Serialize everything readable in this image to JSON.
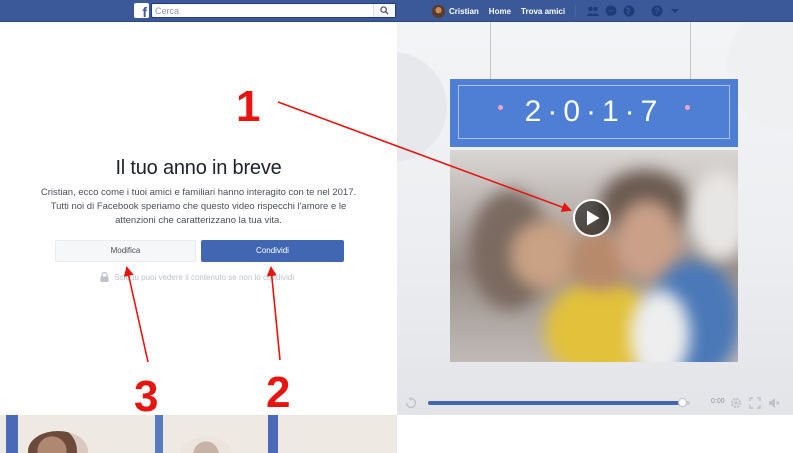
{
  "topbar": {
    "logo_letter": "f",
    "search_placeholder": "Cerca",
    "user_name": "Cristian",
    "links": [
      "Home",
      "Trova amici"
    ]
  },
  "main": {
    "title": "Il tuo anno in breve",
    "description": "Cristian, ecco come i tuoi amici e familiari hanno interagito con te nel 2017. Tutti noi di Facebook speriamo che questo video rispecchi l'amore e le attenzioni che caratterizzano la tua vita.",
    "edit_button": "Modifica",
    "share_button": "Condividi",
    "privacy_note": "Solo tu puoi vedere il contenuto se non lo condividi"
  },
  "video": {
    "year_banner": "2·0·1·7",
    "progress": 0.97,
    "time_label": "0:00"
  },
  "annotations": [
    "1",
    "2",
    "3"
  ],
  "colors": {
    "brand": "#3b5998",
    "primary_button": "#4267b2",
    "banner": "#4e7fd4",
    "annotation": "#e8140f"
  }
}
